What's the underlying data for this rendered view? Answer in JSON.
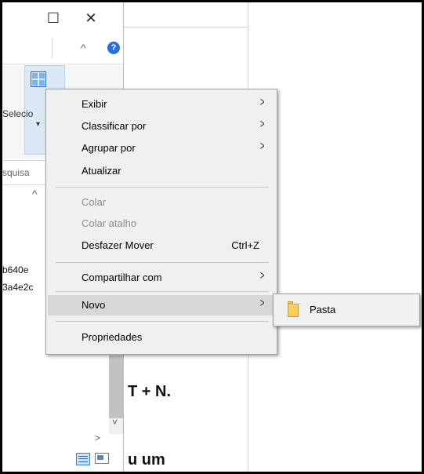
{
  "window": {
    "restore_glyph": "☐",
    "close_glyph": "✕",
    "ribbon_collapse_glyph": "^",
    "help_glyph": "?"
  },
  "ribbon": {
    "select_label": "Selecio",
    "select_caret": "▾"
  },
  "search": {
    "placeholder_fragment": "squisa"
  },
  "list": {
    "sort_glyph": "^",
    "files": [
      "b640e",
      "3a4e2c"
    ]
  },
  "document": {
    "line1": "T + N.",
    "line2": "u um"
  },
  "context_menu": {
    "items": [
      {
        "label": "Exibir",
        "submenu": true
      },
      {
        "label": "Classificar por",
        "submenu": true
      },
      {
        "label": "Agrupar por",
        "submenu": true
      },
      {
        "label": "Atualizar"
      },
      {
        "label": "Colar",
        "disabled": true
      },
      {
        "label": "Colar atalho",
        "disabled": true
      },
      {
        "label": "Desfazer Mover",
        "shortcut": "Ctrl+Z"
      },
      {
        "label": "Compartilhar com",
        "submenu": true
      },
      {
        "label": "Novo",
        "submenu": true,
        "highlighted": true
      },
      {
        "label": "Propriedades"
      }
    ],
    "arrow_glyph": ">"
  },
  "submenu": {
    "items": [
      {
        "label": "Pasta",
        "icon": "folder-icon"
      }
    ]
  },
  "scroll": {
    "down_glyph": "˅",
    "right_glyph": ">"
  },
  "colors": {
    "menu_bg": "#f0f0f0",
    "menu_highlight": "#d7d7d7",
    "disabled_text": "#8d8d8d",
    "window_border": "#e8a6a6",
    "accent": "#2a6fd6",
    "folder": "#f6cf5f"
  }
}
